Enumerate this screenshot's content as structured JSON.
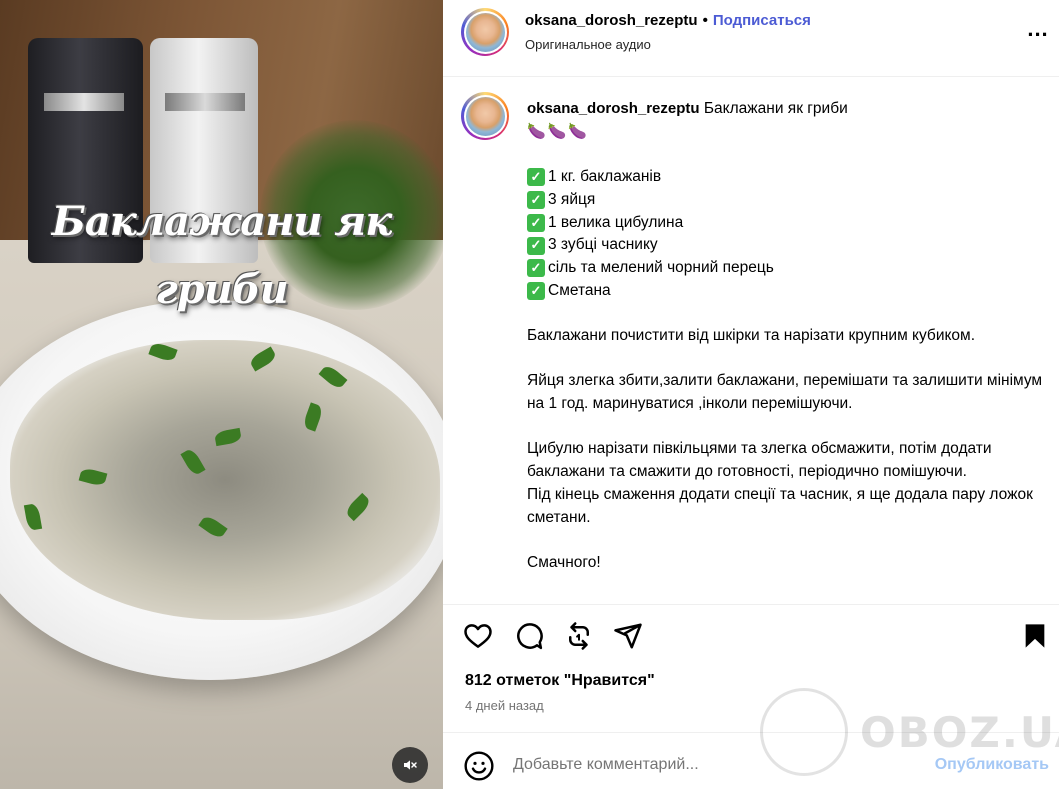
{
  "media": {
    "overlay_title_line1": "Баклажани як",
    "overlay_title_line2": "гриби",
    "mute_icon": "speaker-muted-icon"
  },
  "header": {
    "username": "oksana_dorosh_rezeptu",
    "separator": "•",
    "follow_label": "Подписаться",
    "audio_label": "Оригинальное аудио",
    "more_label": "..."
  },
  "caption": {
    "username": "oksana_dorosh_rezeptu",
    "title": "Баклажани як гриби",
    "emoji_row": "🍆🍆🍆",
    "ingredients": [
      "1 кг. баклажанів",
      "3 яйця",
      "1 велика цибулина",
      "3 зубці часнику",
      "сіль та мелений чорний перець",
      "Сметана"
    ],
    "check_glyph": "✓",
    "paragraphs": [
      "Баклажани почистити від шкірки та нарізати крупним кубиком.",
      "Яйця злегка збити,залити баклажани, перемішати та залишити мінімум на 1 год. маринуватися ,інколи перемішуючи.",
      "Цибулю нарізати півкільцями та злегка обсмажити, потім додати баклажани та смажити до готовності, періодично помішуючи."
    ],
    "last_line": "Під кінець смаження додати спеції та часник, я ще додала пару ложок сметани.",
    "cut_line": "Смачного!"
  },
  "actions": {
    "icons": [
      "heart-icon",
      "comment-icon",
      "repost-icon",
      "share-icon",
      "bookmark-icon"
    ]
  },
  "stats": {
    "likes": "812 отметок \"Нравится\"",
    "date": "4 дней назад"
  },
  "comment": {
    "placeholder": "Добавьте комментарий...",
    "publish_label": "Опубликовать"
  },
  "watermark": {
    "text": "OBOZ.UA"
  },
  "colors": {
    "follow": "#4c5bd4",
    "check": "#3cb94a",
    "publish_disabled": "#a5c8f5",
    "muted_text": "#737373"
  }
}
